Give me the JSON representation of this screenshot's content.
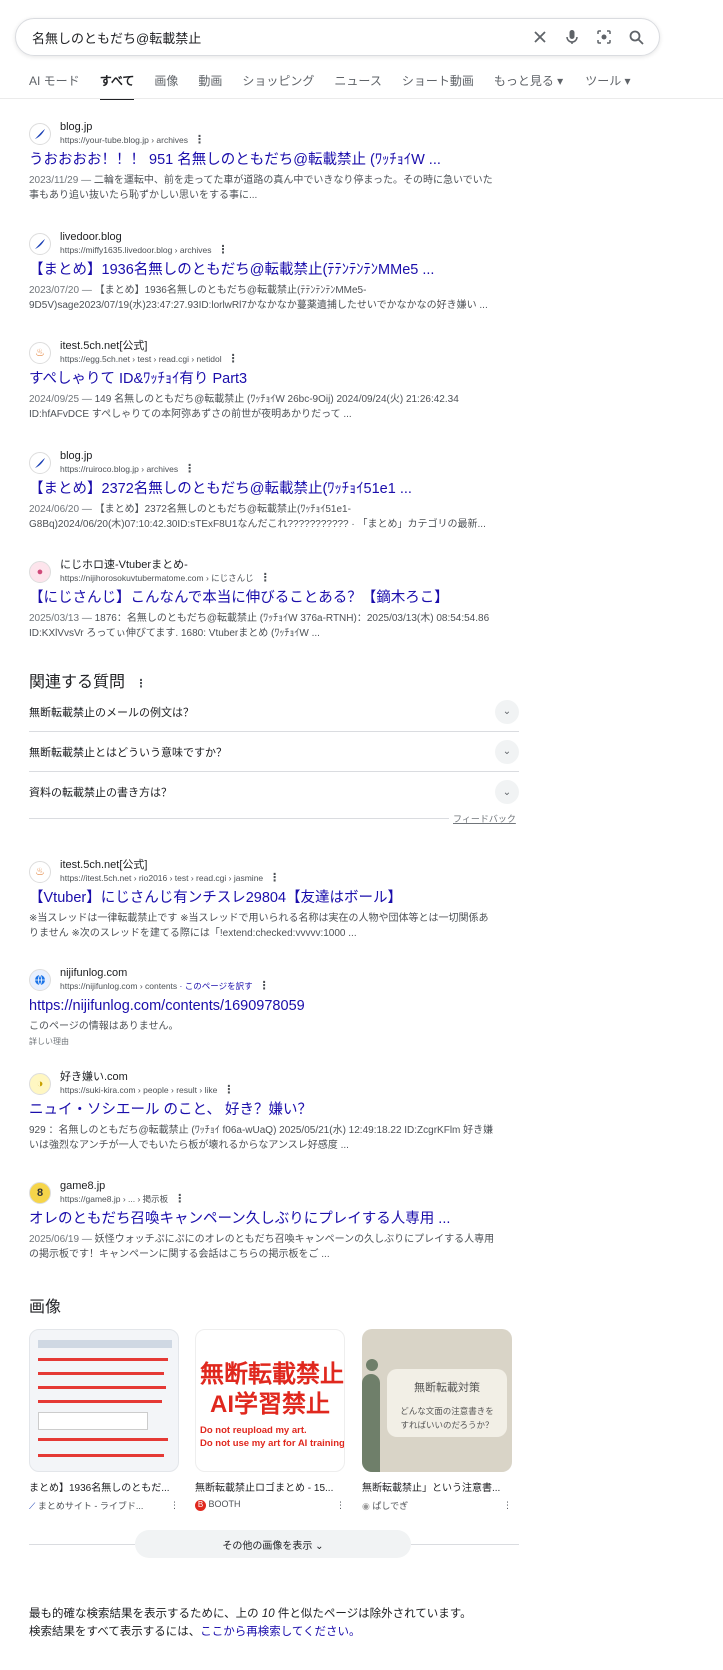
{
  "search": {
    "query": "名無しのともだち@転載禁止"
  },
  "tabs": [
    "AI モード",
    "すべて",
    "画像",
    "動画",
    "ショッピング",
    "ニュース",
    "ショート動画",
    "もっと見る ▾",
    "ツール ▾"
  ],
  "results": [
    {
      "site": "blog.jp",
      "url": "https://your-tube.blog.jp › archives",
      "title": "うおおおお！！！ 951 名無しのともだち@転載禁止 (ﾜｯﾁｮｲW ...",
      "date": "2023/11/29 —",
      "snippet1": " 二輪を運転中、前を走ってた車が道路の真ん中でいきなり停まった。その時に急いでいた",
      "snippet2": "事もあり追い抜いたら恥ずかしい思いをする事に..."
    },
    {
      "site": "livedoor.blog",
      "url": "https://miffy1635.livedoor.blog › archives",
      "title": "【まとめ】1936名無しのともだち@転載禁止(ﾃﾃﾝﾃﾝﾃﾝMMe5 ...",
      "date": "2023/07/20 —",
      "snippet1": " 【まとめ】1936名無しのともだち@転載禁止(ﾃﾃﾝﾃﾝﾃﾝMMe5-",
      "snippet2": "9D5V)sage2023/07/19(水)23:47:27.93ID:lorlwRl7かなかなか蔓薬遺捕したせいでかなかなの好き嫌い ..."
    },
    {
      "site": "itest.5ch.net[公式]",
      "url": "https://egg.5ch.net › test › read.cgi › netidol",
      "title": "すぺしゃりて ID&ﾜｯﾁｮｲ有り Part3",
      "date": "2024/09/25 —",
      "snippet1": " 149 名無しのともだち@転載禁止 (ﾜｯﾁｮｲW 26bc-9Oij) 2024/09/24(火) 21:26:42.34",
      "snippet2": "ID:hfAFvDCE すぺしゃりての本阿弥あずさの前世が夜明あかりだって ..."
    },
    {
      "site": "blog.jp",
      "url": "https://ruiroco.blog.jp › archives",
      "title": "【まとめ】2372名無しのともだち@転載禁止(ﾜｯﾁｮｲ51e1 ...",
      "date": "2024/06/20 —",
      "snippet1": " 【まとめ】2372名無しのともだち@転載禁止(ﾜｯﾁｮｲ51e1-",
      "snippet2": "G8Bq)2024/06/20(木)07:10:42.30ID:sTExF8U1なんだこれ??????????? · 「まとめ」カテゴリの最新..."
    },
    {
      "site": "にじホロ速-Vtuberまとめ-",
      "url": "https://nijihorosokuvtubermatome.com › にじさんじ",
      "title": "【にじさんじ】こんなんで本当に伸びることある？【鏑木ろこ】",
      "date": "2025/03/13 —",
      "snippet1": " 1876：名無しのともだち@転載禁止 (ﾜｯﾁｮｲW 376a-RTNH)：2025/03/13(木) 08:54:54.86",
      "snippet2": "ID:KXlVvsVr ろってぃ伸びてます. 1680: Vtuberまとめ (ﾜｯﾁｮｲW ..."
    }
  ],
  "paa": {
    "title": "関連する質問",
    "questions": [
      "無断転載禁止のメールの例文は？",
      "無断転載禁止とはどういう意味ですか？",
      "資料の転載禁止の書き方は？"
    ],
    "feedback": "フィードバック"
  },
  "results2": [
    {
      "site": "itest.5ch.net[公式]",
      "url": "https://itest.5ch.net › rio2016 › test › read.cgi › jasmine",
      "title": "【Vtuber】にじさんじ有ンチスレ29804【友達はボール】",
      "date": "",
      "snippet1": "※当スレッドは一律転載禁止です ※当スレッドで用いられる名称は実在の人物や団体等とは一切関係あ",
      "snippet2": "りません ※次のスレッドを建てる際には「!extend:checked:vvvvv:1000 ..."
    },
    {
      "site": "nijifunlog.com",
      "url": "https://nijifunlog.com › contents",
      "translate": "· このページを訳す",
      "title": "https://nijifunlog.com/contents/1690978059",
      "date": "",
      "snippet1": "このページの情報はありません。",
      "snippet2": "",
      "detail": "詳しい理由"
    },
    {
      "site": "好き嫌い.com",
      "url": "https://suki-kira.com › people › result › like",
      "title": "ニュイ・ソシエール のこと、 好き？嫌い？",
      "date": "",
      "snippet1": "929 ：名無しのともだち@転載禁止 (ﾜｯﾁｮｲ f06a-wUaQ) 2025/05/21(水) 12:49:18.22 ID:ZcgrKFlm 好き嫌",
      "snippet2": "いは強烈なアンチが一人でもいたら板が壊れるからなアンスレ好感度 ..."
    },
    {
      "site": "game8.jp",
      "url": "https://game8.jp › ... › 掲示板",
      "title": "オレのともだち召喚キャンペーン久しぶりにプレイする人専用 ...",
      "date": "2025/06/19 —",
      "snippet1": " 妖怪ウォッチぷにぷにのオレのともだち召喚キャンペーンの久しぶりにプレイする人専用",
      "snippet2": "の掲示板です！キャンペーンに関する会話はこちらの掲示板をご ..."
    }
  ],
  "images": {
    "heading": "画像",
    "cards": [
      {
        "caption": "まとめ】1936名無しのともだ...",
        "source": "まとめサイト - ライブド..."
      },
      {
        "caption": "無断転載禁止ロゴまとめ - 15...",
        "source": "BOOTH",
        "line1": "無断転載禁止",
        "line2": "AI学習禁止",
        "line3": "Do not reupload my art.",
        "line4": "Do not use my art for AI training"
      },
      {
        "caption": "無断転載禁止」という注意書...",
        "source": "ぱしでぎ",
        "line1": "無断転載対策",
        "line2": "どんな文面の注意書きを",
        "line3": "すればいいのだろうか？"
      }
    ],
    "more": "その他の画像を表示 ⌄"
  },
  "omitted": {
    "line1a": "最も的確な検索結果を表示するために、上の ",
    "count": "10",
    "line1b": " 件と似たページは除外されています。",
    "line2a": "検索結果をすべて表示するには、",
    "link": "ここから再検索してください。"
  }
}
